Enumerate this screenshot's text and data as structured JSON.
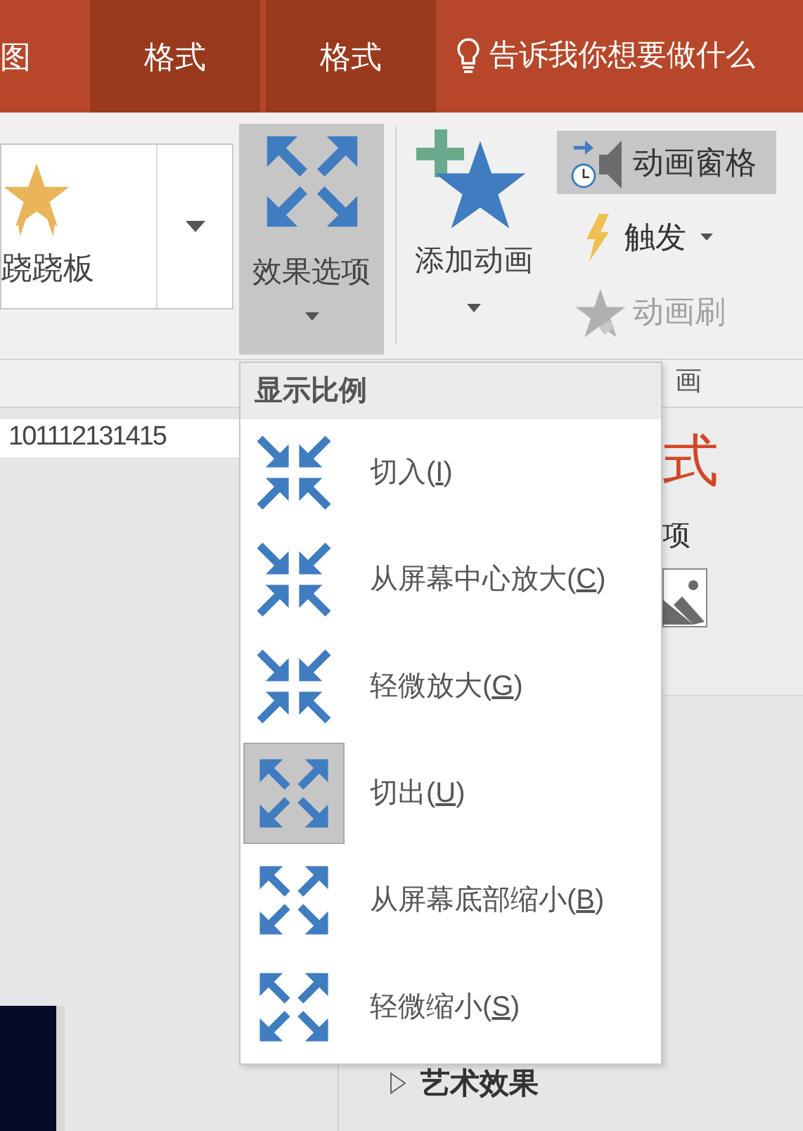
{
  "tabs": [
    {
      "label": "图",
      "kind": "normal"
    },
    {
      "label": "格式",
      "kind": "contextual"
    },
    {
      "label": "格式",
      "kind": "contextual"
    }
  ],
  "search": {
    "placeholder": "告诉我你想要做什么"
  },
  "ribbon": {
    "gallery": {
      "label": "跷跷板"
    },
    "effect_options": {
      "label": "效果选项",
      "pressed": true
    },
    "add_animation": {
      "label": "添加动画"
    },
    "animation_pane": {
      "label": "动画窗格",
      "highlighted": true
    },
    "trigger": {
      "label": "触发"
    },
    "animation_painter": {
      "label": "动画刷",
      "disabled": true
    },
    "group_label": "画"
  },
  "ruler": "101112131415",
  "pane": {
    "heading_fragment": "式",
    "label_fragment": "项",
    "section": "艺术效果",
    "section_expanded": false
  },
  "menu": {
    "header": "显示比例",
    "items": [
      {
        "text_before": "切入(",
        "access_key": "I",
        "text_after": ")",
        "kind": "in",
        "selected": false
      },
      {
        "text_before": "从屏幕中心放大(",
        "access_key": "C",
        "text_after": ")",
        "kind": "in",
        "selected": false
      },
      {
        "text_before": "轻微放大(",
        "access_key": "G",
        "text_after": ")",
        "kind": "in",
        "selected": false
      },
      {
        "text_before": "切出(",
        "access_key": "U",
        "text_after": ")",
        "kind": "out",
        "selected": true
      },
      {
        "text_before": "从屏幕底部缩小(",
        "access_key": "B",
        "text_after": ")",
        "kind": "out",
        "selected": false
      },
      {
        "text_before": "轻微缩小(",
        "access_key": "S",
        "text_after": ")",
        "kind": "out",
        "selected": false
      }
    ]
  }
}
